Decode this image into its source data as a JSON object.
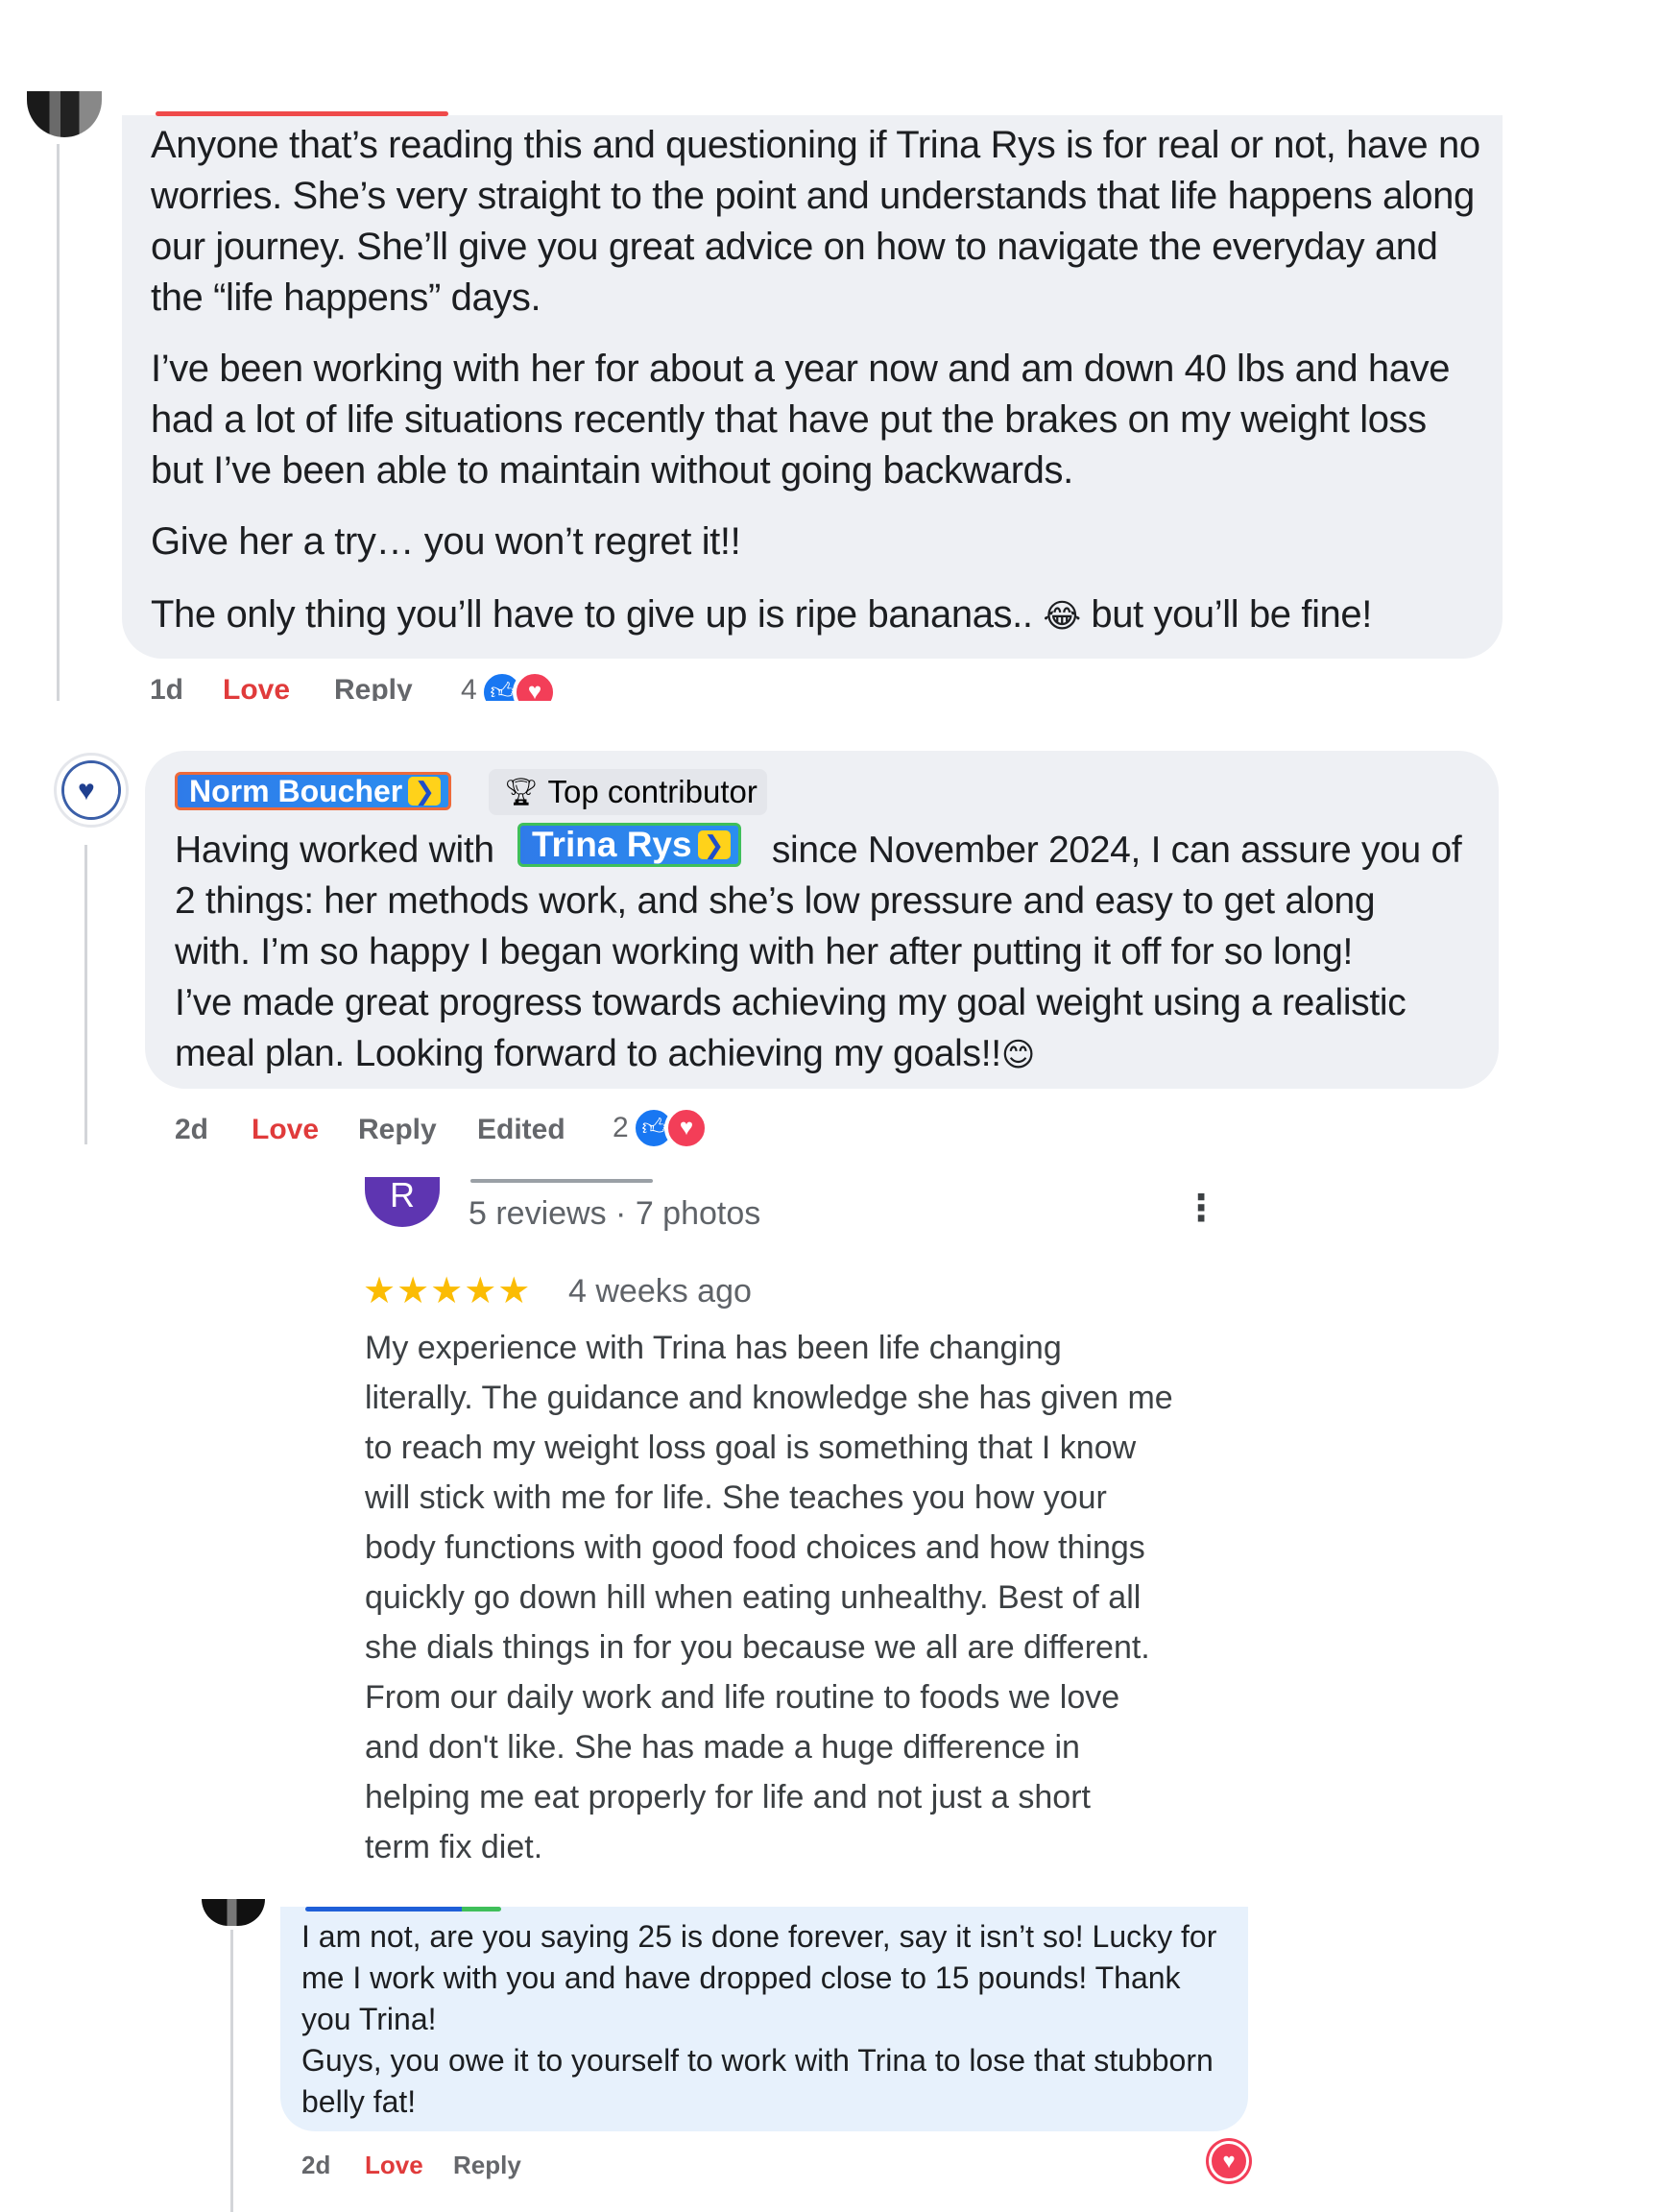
{
  "comment1": {
    "paragraphs": [
      "Anyone that’s reading this and questioning if Trina Rys is for real or not, have no worries. She’s very straight to the point and understands that life happens along our journey. She’ll give you great advice on how to navigate the everyday and the “life happens” days.",
      "I’ve been working with her for about a year now and am down 40 lbs and have had a lot of life situations recently that have put the brakes on my weight loss but I’ve been able to maintain without going backwards.",
      "Give her a try… you won’t regret it!!",
      "The only thing you’ll have to give up is ripe bananas..",
      "but you’ll be fine!"
    ],
    "emoji": "😂",
    "time": "1d",
    "love": "Love",
    "reply": "Reply",
    "reaction_count": "4"
  },
  "comment2": {
    "author": "Norm Boucher",
    "badge": "Top contributor",
    "text_before": "Having worked with",
    "mention": "Trina Rys",
    "text_after": "since November 2024, I can assure you of",
    "lines": [
      "2 things: her methods work, and she’s low pressure and easy to get along",
      "with. I’m so happy I began working with her after putting it off for so long!",
      "I’ve made great progress towards achieving my goal weight using a realistic",
      "meal plan. Looking forward to achieving my goals!!"
    ],
    "emoji": "😊",
    "time": "2d",
    "love": "Love",
    "reply": "Reply",
    "edited": "Edited",
    "reaction_count": "2"
  },
  "review": {
    "avatar_letter": "R",
    "meta": "5 reviews · 7 photos",
    "stars": "★★★★★",
    "rating": 5,
    "date": "4 weeks ago",
    "lines": [
      "My experience with Trina has been life changing",
      "literally. The guidance and knowledge she has given me",
      "to reach my weight loss goal is something that I know",
      "will stick with me for life. She teaches you how your",
      "body functions with good food choices and how things",
      "quickly go down hill when eating unhealthy. Best of all",
      "she dials things in for you because we all are different.",
      "From our daily work and life routine to foods we love",
      "and don't like. She has made a huge difference in",
      "helping me eat properly for life and not just a short",
      "term fix diet."
    ]
  },
  "comment3": {
    "lines": [
      "I am not, are you saying 25 is done forever, say it isn’t so! Lucky for",
      "me I work with you and have dropped close to 15 pounds! Thank",
      "you Trina!",
      "Guys, you owe it to yourself to work with Trina to lose that stubborn",
      "belly fat!"
    ],
    "time": "2d",
    "love": "Love",
    "reply": "Reply"
  },
  "colors": {
    "love": "#e03b3b",
    "like": "#1877f2",
    "heart": "#f33e58",
    "bubble": "#eef0f4",
    "reply_bubble": "#e7f1fc",
    "star": "#fbbc04"
  }
}
